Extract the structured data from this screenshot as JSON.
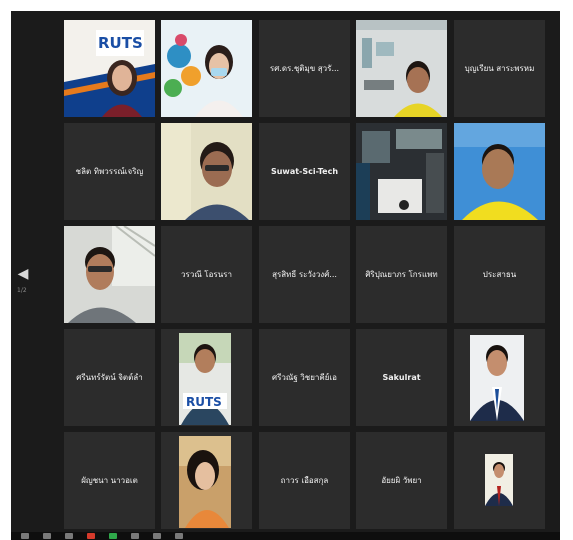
{
  "meeting": {
    "page_indicator": "1/2",
    "participants": [
      {
        "name": "",
        "video": true
      },
      {
        "name": "",
        "video": true
      },
      {
        "name": "รศ.ดร.ชุติมุข สุวรั...",
        "video": false
      },
      {
        "name": "",
        "video": true
      },
      {
        "name": "บุญเรียน สาระพรหม",
        "video": false
      },
      {
        "name": "ชลิต ทิพวรรณ์เจริญ",
        "video": false
      },
      {
        "name": "",
        "video": true
      },
      {
        "name": "Suwat-Sci-Tech",
        "video": false
      },
      {
        "name": "",
        "video": true
      },
      {
        "name": "",
        "video": true,
        "active_speaker": true
      },
      {
        "name": "",
        "video": true
      },
      {
        "name": "วรวณี โอรนรา",
        "video": false
      },
      {
        "name": "สุรสิทธิ์ ระวังวงศ์...",
        "video": false
      },
      {
        "name": "ศิริปุณยาภร โกรแพท",
        "video": false
      },
      {
        "name": "ประสาธน",
        "video": false
      },
      {
        "name": "ศรีนทร์รัตน์ จิตต์ล้ำ",
        "video": false
      },
      {
        "name": "",
        "video": true,
        "logo_text": "RUTS"
      },
      {
        "name": "ศรีวณัฐ วิชยาคีย์เอ",
        "video": false
      },
      {
        "name": "Sakulrat",
        "video": false
      },
      {
        "name": "",
        "video": true
      },
      {
        "name": "ผัญชนา นาวอเต",
        "video": false
      },
      {
        "name": "",
        "video": true
      },
      {
        "name": "ถาวร เอื้อสกุล",
        "video": false
      },
      {
        "name": "อัยยผิ วัพยา",
        "video": false
      },
      {
        "name": "",
        "video": true
      }
    ],
    "logo_text_first": "RUTS"
  },
  "colors": {
    "background": "#1b1b1b",
    "tile": "#2c2c2c",
    "active_border": "#e6e23c",
    "name_text": "#f2f2f2"
  },
  "icons": {
    "prev_page": "chevron-left-icon"
  }
}
